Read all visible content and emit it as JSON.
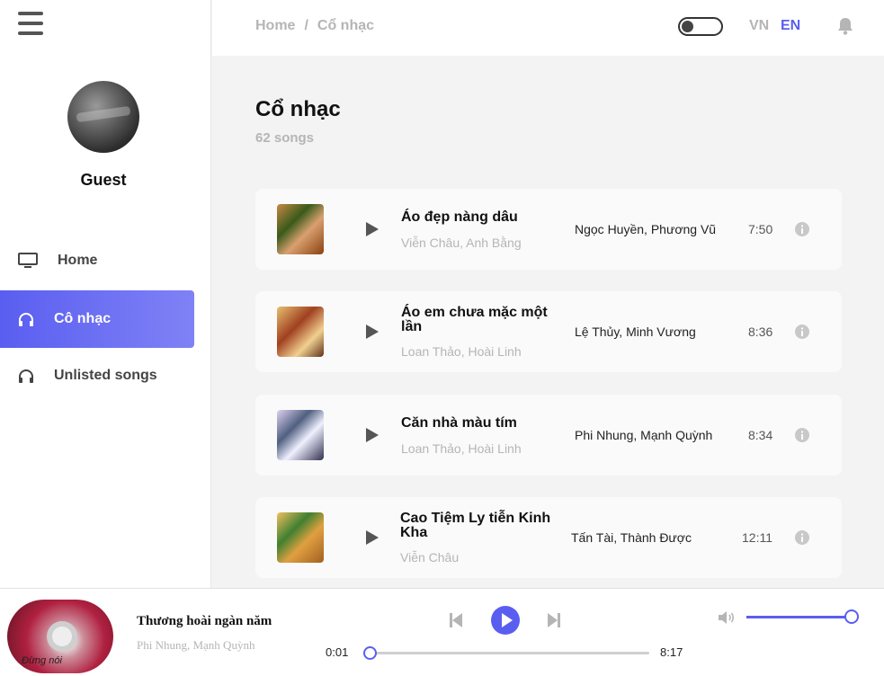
{
  "sidebar": {
    "username": "Guest",
    "items": [
      {
        "label": "Home",
        "icon": "monitor-icon"
      },
      {
        "label": "Cô nhạc",
        "icon": "headphones-icon",
        "active": true
      },
      {
        "label": "Unlisted songs",
        "icon": "headphones-icon"
      }
    ]
  },
  "header": {
    "breadcrumb": {
      "home": "Home",
      "separator": "/",
      "current": "Cổ nhạc"
    },
    "lang_vn": "VN",
    "lang_en": "EN",
    "active_lang": "EN",
    "theme_toggle_on": false
  },
  "main": {
    "title": "Cổ nhạc",
    "count": "62 songs",
    "songs": [
      {
        "title": "Áo đẹp nàng dâu",
        "composer": "Viễn Châu, Anh Bằng",
        "singers": "Ngọc Huyền, Phương Vũ",
        "duration": "7:50"
      },
      {
        "title": "Áo em chưa mặc một lần",
        "composer": "Loan Thảo, Hoài Linh",
        "singers": "Lệ Thủy, Minh Vương",
        "duration": "8:36"
      },
      {
        "title": "Căn nhà màu tím",
        "composer": "Loan Thảo, Hoài Linh",
        "singers": "Phi Nhung, Mạnh Quỳnh",
        "duration": "8:34"
      },
      {
        "title": "Cao Tiệm Ly tiễn Kinh Kha",
        "composer": "Viễn Châu",
        "singers": "Tấn Tài, Thành Được",
        "duration": "12:11"
      }
    ]
  },
  "player": {
    "title": "Thương hoài ngàn năm",
    "artist": "Phi Nhung, Mạnh Quỳnh",
    "cover_text": "Đừng nói",
    "current_time": "0:01",
    "total_time": "8:17",
    "progress": 0.002,
    "volume": 1.0
  },
  "colors": {
    "accent": "#5a5ef0",
    "muted": "#b5b5b5"
  }
}
